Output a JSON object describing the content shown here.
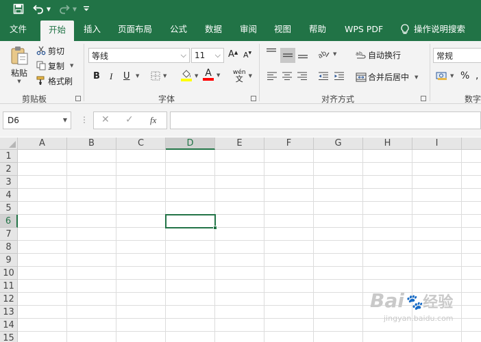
{
  "quick_access": {
    "icons": [
      "save-icon",
      "undo-icon",
      "undo-dropdown-icon",
      "redo-icon",
      "redo-dropdown-icon",
      "customize-qat-icon"
    ]
  },
  "tabs": [
    {
      "label": "文件"
    },
    {
      "label": "开始",
      "active": true
    },
    {
      "label": "插入"
    },
    {
      "label": "页面布局"
    },
    {
      "label": "公式"
    },
    {
      "label": "数据"
    },
    {
      "label": "审阅"
    },
    {
      "label": "视图"
    },
    {
      "label": "帮助"
    },
    {
      "label": "WPS PDF"
    }
  ],
  "tell_me": {
    "label": "操作说明搜索",
    "icon": "lightbulb-icon"
  },
  "clipboard": {
    "paste_label": "粘贴",
    "cut_label": "剪切",
    "copy_label": "复制",
    "format_painter_label": "格式刷",
    "group_label": "剪贴板"
  },
  "font": {
    "font_name": "等线",
    "font_size": "11",
    "bold": "B",
    "italic": "I",
    "underline": "U",
    "grow": "A",
    "shrink": "A",
    "font_color_glyph": "A",
    "phonetic_top": "wén",
    "phonetic_bottom": "文",
    "group_label": "字体",
    "highlight_color": "#ffff00",
    "font_color": "#ff0000"
  },
  "alignment": {
    "wrap_text_label": "自动换行",
    "merge_center_label": "合并后居中",
    "group_label": "对齐方式"
  },
  "number": {
    "format": "常规",
    "percent": "%",
    "group_label": "数字"
  },
  "formula_bar": {
    "name_box": "D6",
    "cancel_glyph": "✕",
    "enter_glyph": "✓",
    "fx_label": "fx",
    "formula": ""
  },
  "sheet": {
    "columns": [
      "A",
      "B",
      "C",
      "D",
      "E",
      "F",
      "G",
      "H",
      "I"
    ],
    "rows": [
      "1",
      "2",
      "3",
      "4",
      "5",
      "6",
      "7",
      "8",
      "9",
      "10",
      "11",
      "12",
      "13",
      "14",
      "15"
    ],
    "selected_column": "D",
    "selected_row": "6"
  },
  "watermark": {
    "brand": "Bai",
    "brand2": "经验",
    "url": "jingyan.baidu.com"
  },
  "colors": {
    "accent": "#217346",
    "ribbon_bg": "#f3f3f3",
    "header_bg": "#e6e6e6"
  }
}
